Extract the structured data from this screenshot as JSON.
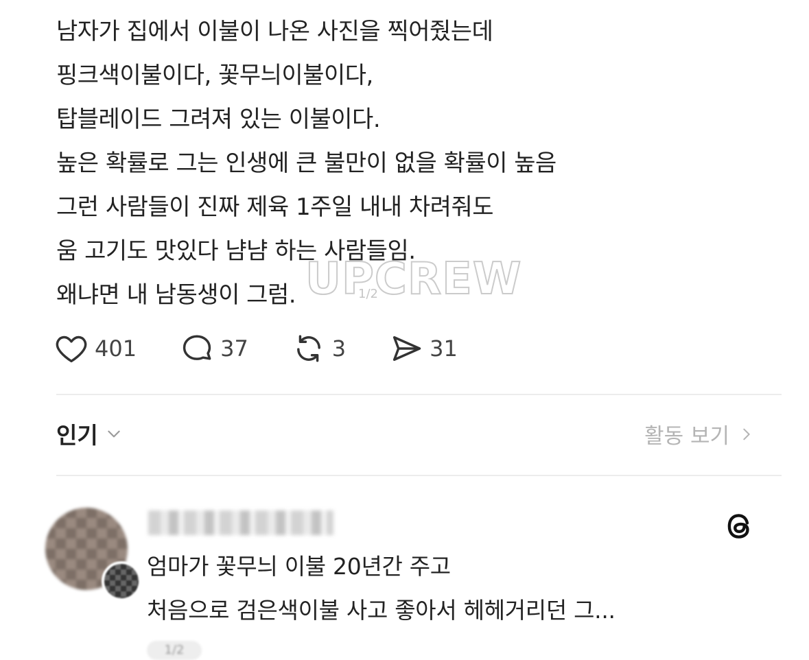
{
  "post": {
    "lines": [
      "남자가 집에서 이불이 나온 사진을 찍어줬는데",
      "핑크색이불이다, 꽃무늬이불이다,",
      "탑블레이드 그려져 있는 이불이다.",
      "높은 확률로 그는 인생에 큰 불만이 없을 확률이 높음",
      "그런 사람들이 진짜 제육 1주일 내내 차려줘도",
      "움 고기도 맛있다 냠냠 하는 사람들임.",
      "왜냐면 내 남동생이 그럼."
    ],
    "page_indicator": "1/2",
    "watermark": "UPCREW"
  },
  "actions": {
    "likes": "401",
    "comments": "37",
    "reposts": "3",
    "shares": "31"
  },
  "sort": {
    "label": "인기",
    "activity_label": "활동 보기"
  },
  "reply": {
    "lines": [
      "엄마가 꽃무늬 이불 20년간 주고",
      "처음으로 검은색이불 사고 좋아서 헤헤거리던 그..."
    ],
    "page_indicator": "1/2"
  },
  "icons": {
    "like": "heart-icon",
    "comment": "comment-bubble-icon",
    "repost": "repost-icon",
    "share": "send-icon",
    "sort": "chevron-down-icon",
    "activity": "chevron-right-icon",
    "threads": "threads-logo-icon"
  },
  "colors": {
    "text": "#222222",
    "muted": "#b4b4b4",
    "divider": "#ececec"
  }
}
